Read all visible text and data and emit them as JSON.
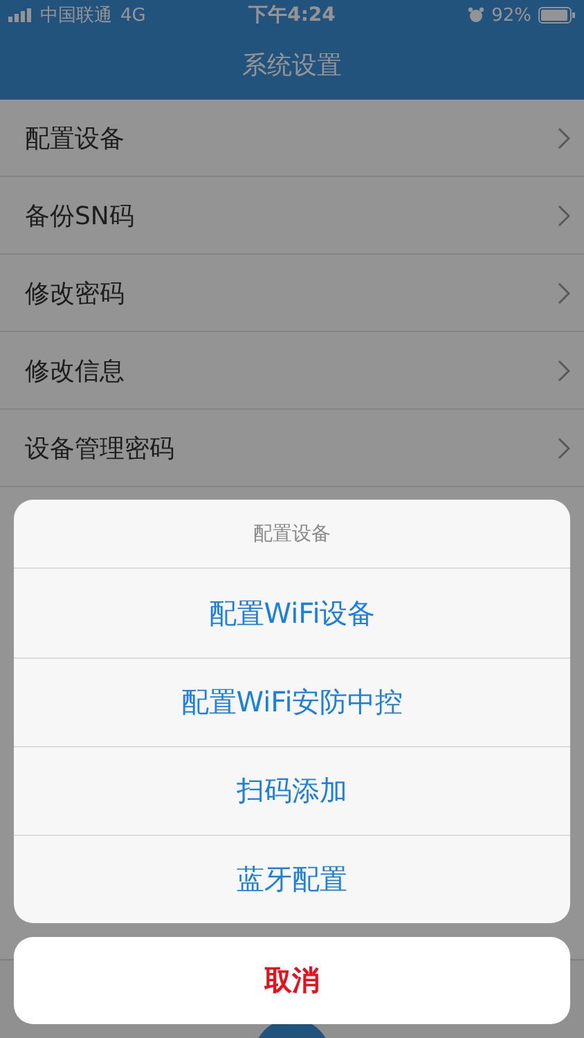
{
  "status_bar": {
    "carrier": "中国联通",
    "network": "4G",
    "time": "下午4:24",
    "battery": "92%"
  },
  "nav": {
    "title": "系统设置"
  },
  "menu": [
    {
      "label": "配置设备"
    },
    {
      "label": "备份SN码"
    },
    {
      "label": "修改密码"
    },
    {
      "label": "修改信息"
    },
    {
      "label": "设备管理密码"
    }
  ],
  "action_sheet": {
    "title": "配置设备",
    "options": [
      "配置WiFi设备",
      "配置WiFi安防中控",
      "扫码添加",
      "蓝牙配置"
    ],
    "cancel": "取消"
  }
}
